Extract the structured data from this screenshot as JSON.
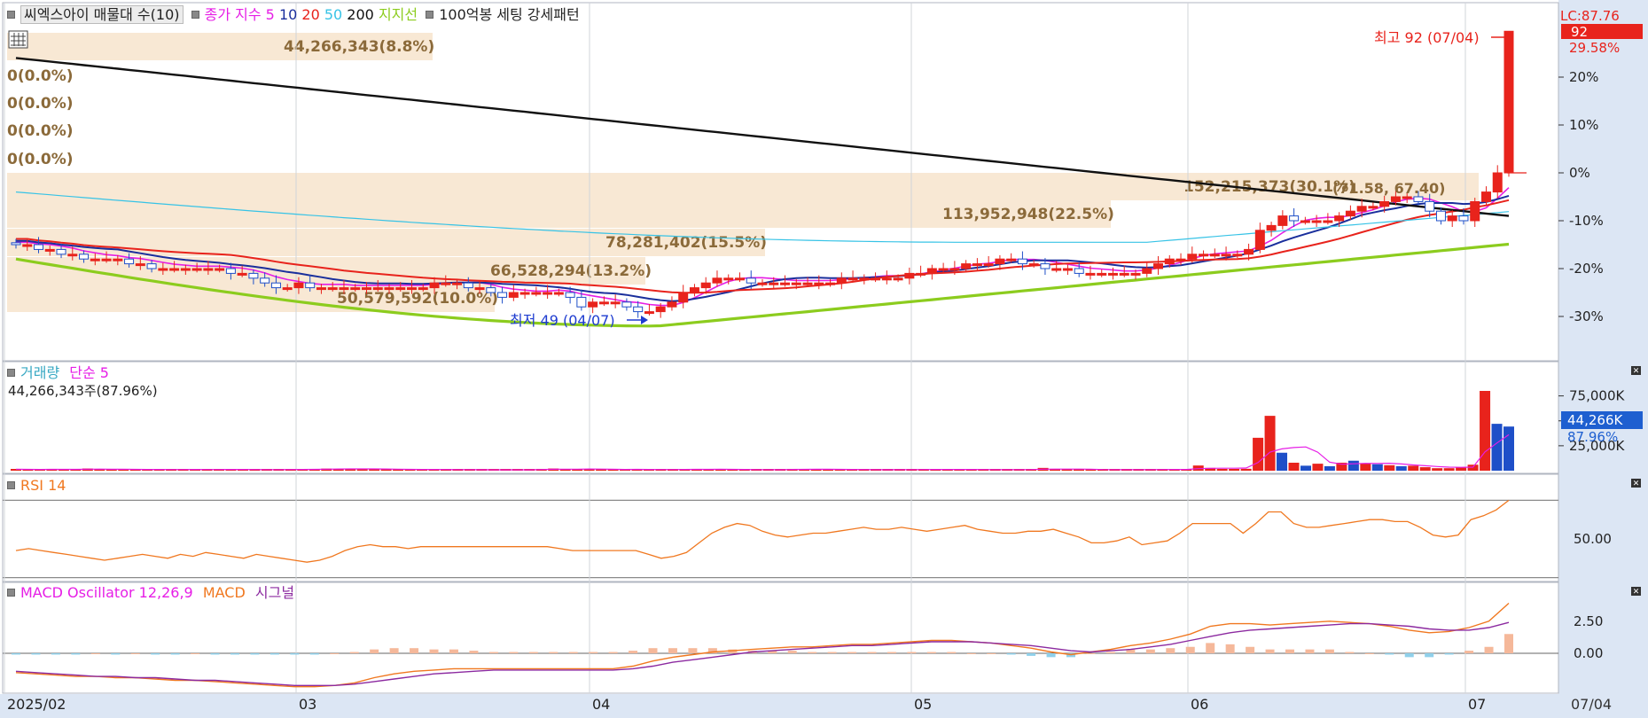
{
  "legend_price": {
    "stock_name": "씨엑스아이 매물대 수(10)",
    "ma_title": "종가 지수",
    "ma_periods": [
      "5",
      "10",
      "20",
      "50",
      "200"
    ],
    "support_label": "지지선",
    "pattern_label": "100억봉 세팅 강세패턴"
  },
  "price_right_labels": {
    "lc": "LC:87.76",
    "current": "92",
    "current_pct": "29.58%"
  },
  "volume_profile": [
    "44,266,343(8.8%)",
    "0(0.0%)",
    "0(0.0%)",
    "0(0.0%)",
    "0(0.0%)",
    "152,215,373(30.1%)",
    "113,952,948(22.5%)",
    "78,281,402(15.5%)",
    "66,528,294(13.2%)",
    "50,579,592(10.0%)"
  ],
  "price_annotations": {
    "high": "최고 92 (07/04)",
    "low": "최저 49 (04/07)",
    "ohlc_overlap": "(71.58, 67.40)"
  },
  "volume_panel": {
    "title": "거래량",
    "ma_label": "단순 5",
    "current": "44,266,343주(87.96%)",
    "badge_value": "44,266K",
    "badge_pct": "87.96%"
  },
  "rsi_panel": {
    "title": "RSI 14"
  },
  "macd_panel": {
    "title": "MACD Oscillator 12,26,9",
    "macd_label": "MACD",
    "signal_label": "시그널"
  },
  "x_axis": {
    "labels": [
      "2025/02",
      "03",
      "04",
      "05",
      "06",
      "07"
    ],
    "current_date": "07/04"
  },
  "colors": {
    "up": "#e8231c",
    "down": "#1e4fc8",
    "ma5": "#e61ee6",
    "ma10": "#1a2f9c",
    "ma20": "#e8231c",
    "ma50": "#37c3e6",
    "ma200": "#111111",
    "support": "#8ccc1e",
    "profile": "#f7e6cf",
    "axis_bg": "#dce6f4",
    "rsi": "#f07820",
    "macd": "#f07820",
    "signal": "#8c2aa0"
  },
  "chart_data": [
    {
      "type": "candlestick",
      "title": "씨엑스아이 매물대 수(10)",
      "x_start": "2025/02",
      "x_end": "07/04",
      "ylim_pct": [
        -33,
        30
      ],
      "y_ticks_pct": [
        "20%",
        "10%",
        "0%",
        "-10%",
        "-20%",
        "-30%"
      ],
      "reference_price": 71.0,
      "high": {
        "value": 92,
        "date": "07/04"
      },
      "low": {
        "value": 49,
        "date": "04/07"
      },
      "close_pct_approx": [
        -15,
        -15,
        -16,
        -16,
        -17,
        -17,
        -18,
        -18,
        -18,
        -18,
        -19,
        -19,
        -20,
        -20,
        -20,
        -20,
        -20,
        -20,
        -20,
        -21,
        -21,
        -22,
        -23,
        -24,
        -24,
        -23,
        -24,
        -24,
        -24,
        -24,
        -24,
        -24,
        -24,
        -24,
        -24,
        -24,
        -24,
        -23,
        -23,
        -23,
        -24,
        -24,
        -25,
        -26,
        -25,
        -25,
        -25,
        -25,
        -25,
        -26,
        -28,
        -27,
        -27,
        -27,
        -28,
        -29,
        -29,
        -28,
        -27,
        -25,
        -24,
        -23,
        -22,
        -22,
        -22,
        -23,
        -23,
        -23,
        -23,
        -23,
        -23,
        -23,
        -23,
        -22,
        -22,
        -22,
        -22,
        -22,
        -22,
        -21,
        -21,
        -20,
        -20,
        -20,
        -19,
        -19,
        -19,
        -18,
        -18,
        -19,
        -19,
        -20,
        -20,
        -20,
        -21,
        -21,
        -21,
        -21,
        -21,
        -21,
        -20,
        -19,
        -18,
        -18,
        -17,
        -17,
        -17,
        -17,
        -17,
        -16,
        -12,
        -11,
        -9,
        -10,
        -10,
        -10,
        -10,
        -9,
        -8,
        -7,
        -7,
        -6,
        -5,
        -5,
        -6,
        -8,
        -10,
        -9,
        -10,
        -6,
        -4,
        0,
        29.58
      ],
      "ma_lines": [
        "5",
        "10",
        "20",
        "50",
        "200"
      ],
      "support_line": "지지선"
    },
    {
      "type": "bar",
      "title": "거래량",
      "unit": "K shares",
      "y_ticks": [
        "75,000K",
        "50,000K",
        "25,000K"
      ],
      "ylim": [
        0,
        82000
      ],
      "last_value": 44266,
      "values_approx": [
        1500,
        1200,
        1000,
        1800,
        1100,
        1600,
        2200,
        1300,
        1100,
        1200,
        1000,
        1500,
        1200,
        900,
        1100,
        1300,
        1400,
        1200,
        1000,
        1100,
        1200,
        1000,
        900,
        1700,
        1600,
        1400,
        2100,
        1800,
        2000,
        1700,
        1500,
        1300,
        1100,
        1000,
        1200,
        1400,
        900,
        1000,
        800,
        700,
        900,
        1000,
        1100,
        900,
        1800,
        2200,
        1700,
        1000,
        1600,
        1400,
        1200,
        1100,
        1400,
        1100,
        1100,
        1200,
        1500,
        1800,
        1200,
        1400,
        900,
        900,
        1000,
        1100,
        1200,
        1800,
        1400,
        1500,
        1100,
        1000,
        1200,
        1000,
        900,
        1000,
        1100,
        1300,
        1400,
        1400,
        1200,
        1000,
        1100,
        1000,
        1000,
        1100,
        1300,
        1400,
        2800,
        1400,
        1100,
        1100,
        1200,
        1000,
        1100,
        1000,
        1200,
        1100,
        1300,
        1500,
        1200,
        5200,
        2800,
        1800,
        1600,
        1900,
        33000,
        55000,
        18000,
        8000,
        5000,
        7000,
        4500,
        8000,
        10000,
        7500,
        6500,
        5500,
        4500,
        5000,
        3500,
        2500,
        2500,
        3300,
        6000,
        80000,
        47000,
        44266
      ]
    },
    {
      "type": "line",
      "title": "RSI 14",
      "y_ticks": [
        "50.00"
      ],
      "values_approx": [
        44,
        45,
        44,
        43,
        42,
        41,
        40,
        39,
        40,
        41,
        42,
        41,
        40,
        42,
        41,
        43,
        42,
        41,
        40,
        42,
        41,
        40,
        39,
        38,
        39,
        41,
        44,
        46,
        47,
        46,
        46,
        45,
        46,
        46,
        46,
        46,
        46,
        46,
        46,
        46,
        46,
        46,
        46,
        45,
        44,
        44,
        44,
        44,
        44,
        44,
        42,
        40,
        41,
        43,
        48,
        53,
        56,
        58,
        57,
        54,
        52,
        51,
        52,
        53,
        53,
        54,
        55,
        56,
        55,
        55,
        56,
        55,
        54,
        55,
        56,
        57,
        55,
        54,
        53,
        53,
        54,
        54,
        55,
        53,
        51,
        48,
        48,
        49,
        51,
        47,
        48,
        49,
        53,
        58,
        58,
        58,
        58,
        53,
        58,
        64,
        64,
        58,
        56,
        56,
        57,
        58,
        59,
        60,
        60,
        59,
        59,
        56,
        52,
        51,
        52,
        60,
        62,
        65,
        70
      ]
    },
    {
      "type": "line+bar",
      "title": "MACD Oscillator 12,26,9",
      "y_ticks": [
        "2.50",
        "0.00"
      ],
      "macd_approx": [
        -1.5,
        -1.6,
        -1.7,
        -1.8,
        -1.8,
        -1.9,
        -1.9,
        -2.0,
        -2.1,
        -2.1,
        -2.2,
        -2.3,
        -2.4,
        -2.5,
        -2.6,
        -2.6,
        -2.5,
        -2.3,
        -1.9,
        -1.6,
        -1.4,
        -1.3,
        -1.2,
        -1.2,
        -1.2,
        -1.2,
        -1.2,
        -1.2,
        -1.2,
        -1.2,
        -1.2,
        -1.0,
        -0.6,
        -0.3,
        -0.1,
        0.1,
        0.2,
        0.3,
        0.4,
        0.5,
        0.5,
        0.6,
        0.7,
        0.7,
        0.8,
        0.9,
        1.0,
        1.0,
        0.9,
        0.8,
        0.6,
        0.4,
        0.1,
        -0.1,
        0.1,
        0.3,
        0.6,
        0.8,
        1.1,
        1.5,
        2.1,
        2.3,
        2.3,
        2.2,
        2.3,
        2.4,
        2.5,
        2.4,
        2.3,
        2.1,
        1.8,
        1.6,
        1.7,
        2.0,
        2.5,
        3.9
      ],
      "signal_approx": [
        -1.4,
        -1.5,
        -1.6,
        -1.7,
        -1.8,
        -1.8,
        -1.9,
        -1.9,
        -2.0,
        -2.1,
        -2.1,
        -2.2,
        -2.3,
        -2.4,
        -2.5,
        -2.5,
        -2.5,
        -2.4,
        -2.2,
        -2.0,
        -1.8,
        -1.6,
        -1.5,
        -1.4,
        -1.3,
        -1.3,
        -1.3,
        -1.3,
        -1.3,
        -1.3,
        -1.3,
        -1.2,
        -1.0,
        -0.7,
        -0.5,
        -0.3,
        -0.1,
        0.1,
        0.2,
        0.3,
        0.4,
        0.5,
        0.6,
        0.6,
        0.7,
        0.8,
        0.9,
        0.9,
        0.9,
        0.8,
        0.7,
        0.6,
        0.4,
        0.2,
        0.1,
        0.2,
        0.3,
        0.5,
        0.7,
        1.0,
        1.3,
        1.6,
        1.8,
        1.9,
        2.0,
        2.1,
        2.2,
        2.3,
        2.3,
        2.2,
        2.1,
        1.9,
        1.8,
        1.8,
        2.0,
        2.4
      ],
      "oscillator_approx": [
        -0.1,
        -0.1,
        -0.1,
        -0.1,
        0,
        -0.1,
        0,
        -0.1,
        -0.1,
        0,
        -0.1,
        -0.1,
        -0.1,
        -0.1,
        -0.1,
        -0.1,
        0,
        0.1,
        0.3,
        0.4,
        0.4,
        0.3,
        0.3,
        0.2,
        0.1,
        0.1,
        0.1,
        0.1,
        0.1,
        0.1,
        0.1,
        0.2,
        0.4,
        0.4,
        0.4,
        0.4,
        0.3,
        0.2,
        0.2,
        0.2,
        0.1,
        0.1,
        0.1,
        0.1,
        0.1,
        0.1,
        0.1,
        0.1,
        0,
        0,
        -0.1,
        -0.2,
        -0.3,
        -0.3,
        0,
        0.1,
        0.3,
        0.3,
        0.4,
        0.5,
        0.8,
        0.7,
        0.5,
        0.3,
        0.3,
        0.3,
        0.3,
        0.1,
        0,
        -0.1,
        -0.3,
        -0.3,
        -0.1,
        0.2,
        0.5,
        1.5
      ]
    }
  ]
}
